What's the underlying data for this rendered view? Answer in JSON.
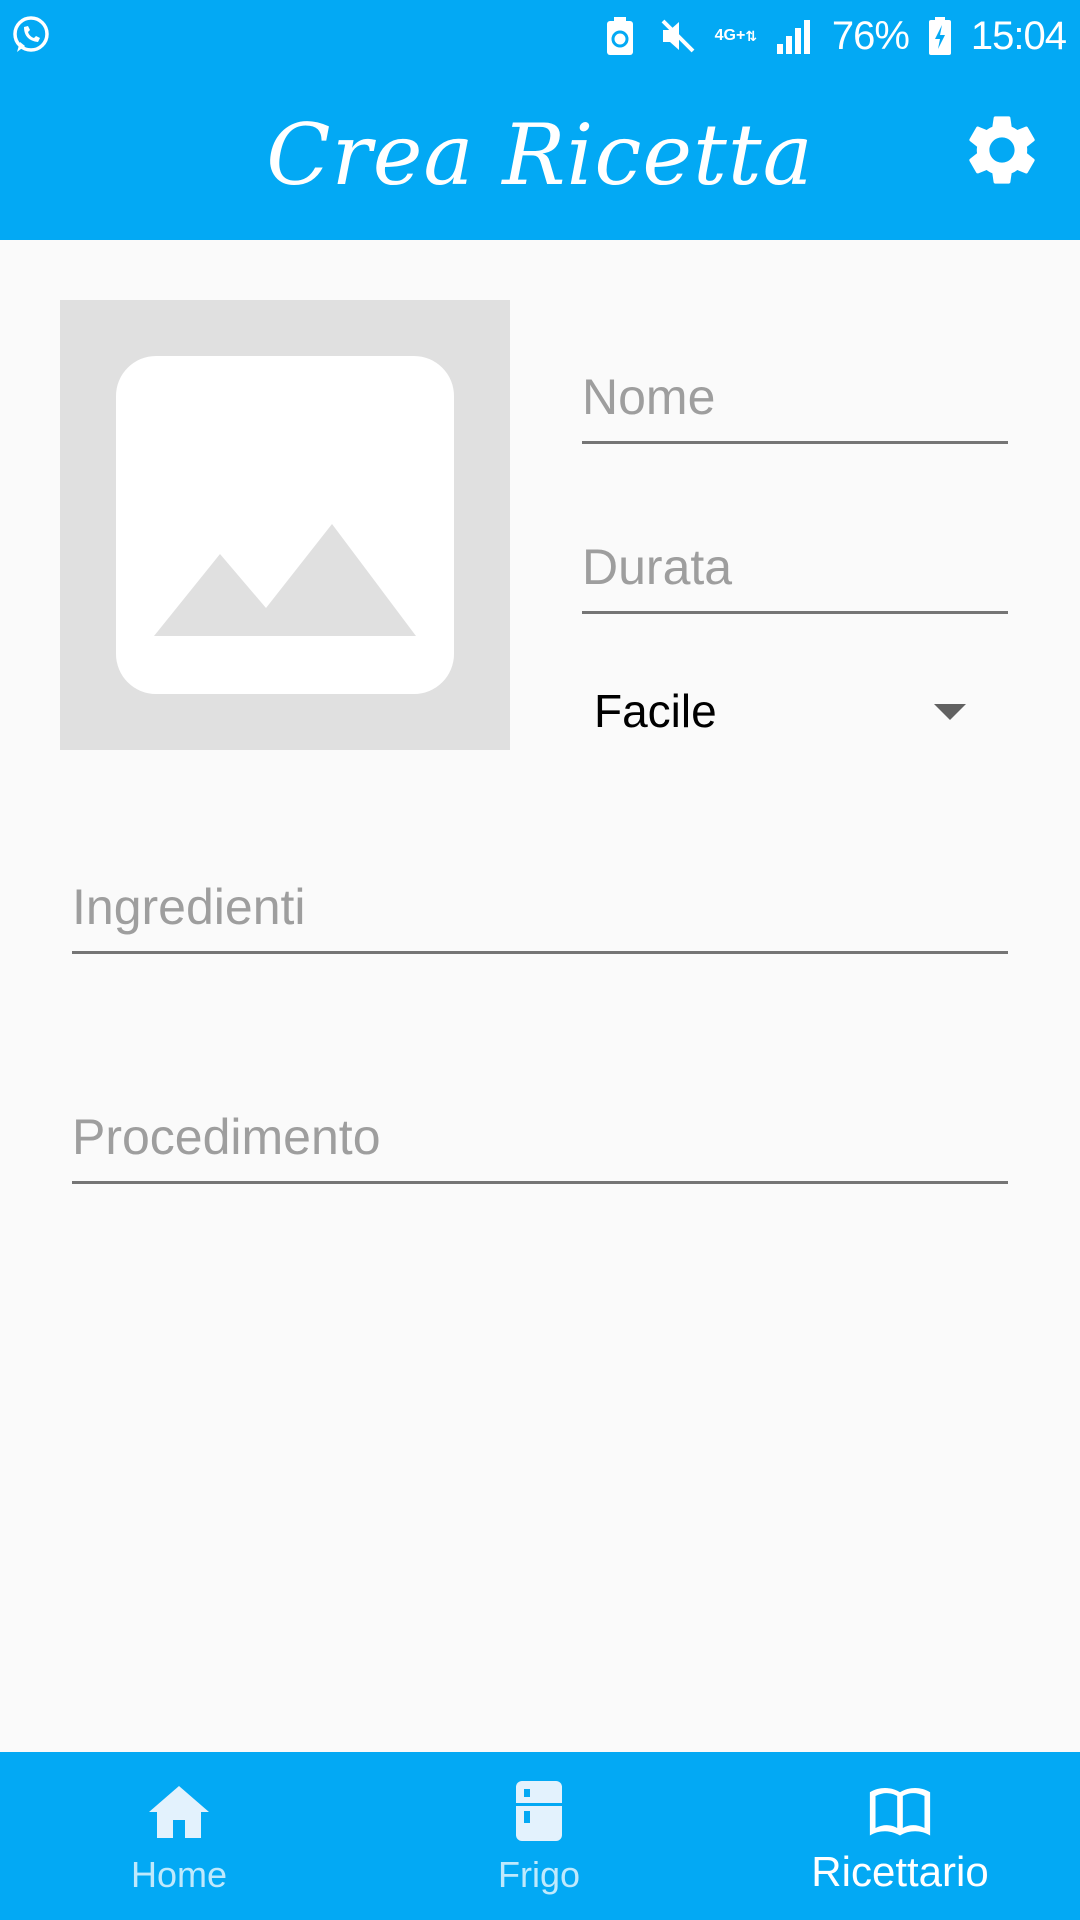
{
  "status_bar": {
    "battery_percent": "76%",
    "time": "15:04",
    "network_type": "4G+",
    "icons": [
      "whatsapp-icon",
      "battery-saver-icon",
      "mute-icon",
      "network-type-icon",
      "signal-icon",
      "battery-charging-icon"
    ]
  },
  "app_bar": {
    "title": "Crea Ricetta",
    "settings_icon": "gear-icon"
  },
  "form": {
    "image_placeholder_icon": "image-placeholder-icon",
    "nome_placeholder": "Nome",
    "durata_placeholder": "Durata",
    "difficulty_selected": "Facile",
    "ingredienti_placeholder": "Ingredienti",
    "procedimento_placeholder": "Procedimento"
  },
  "bottom_nav": {
    "items": [
      {
        "label": "Home",
        "icon": "home-icon",
        "active": false
      },
      {
        "label": "Frigo",
        "icon": "fridge-icon",
        "active": false
      },
      {
        "label": "Ricettario",
        "icon": "book-icon",
        "active": true
      }
    ]
  },
  "colors": {
    "primary": "#03a9f4",
    "background": "#fafafa",
    "placeholder_bg": "#e0e0e0",
    "hint_text": "#9e9e9e",
    "underline": "#757575"
  }
}
